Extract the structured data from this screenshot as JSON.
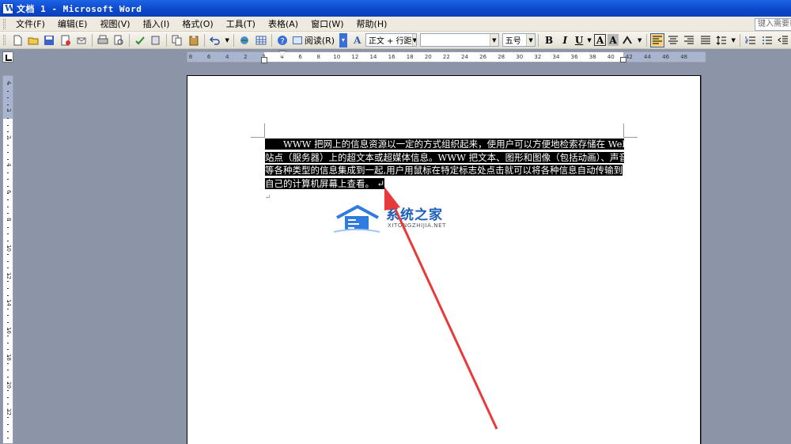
{
  "window": {
    "title": "文档 1 - Microsoft Word"
  },
  "menu": {
    "items": [
      "文件(F)",
      "编辑(E)",
      "视图(V)",
      "插入(I)",
      "格式(O)",
      "工具(T)",
      "表格(A)",
      "窗口(W)",
      "帮助(H)"
    ],
    "help_placeholder": "键入需要帮助的问题"
  },
  "toolbar": {
    "read_label": "阅读(R)",
    "style_value": "正文 + 行距",
    "font_value": "",
    "size_value": "五号",
    "bold": "B",
    "italic": "I",
    "underline": "U",
    "char_border": "A",
    "char_shade": "A"
  },
  "ruler": {
    "h_ticks": [
      "8",
      "6",
      "4",
      "2",
      "2",
      "4",
      "6",
      "8",
      "10",
      "12",
      "14",
      "16",
      "18",
      "20",
      "22",
      "24",
      "26",
      "28",
      "30",
      "32",
      "34",
      "36",
      "38",
      "40",
      "42",
      "44",
      "46",
      "48"
    ],
    "v_ticks": [
      "4",
      "2",
      "2",
      "4",
      "6",
      "8",
      "10",
      "12",
      "14",
      "16",
      "18",
      "20",
      "22"
    ]
  },
  "document": {
    "lines": [
      "　　WWW 把网上的信息资源以一定的方式组织起来，使用户可以方便地检索存储在 Web",
      "站点（服务器）上的超文本或超媒体信息。WWW 把文本、图形和图像（包括动画）、声音",
      "等各种类型的信息集成到一起,用户用鼠标在特定标志处点击就可以将各种信息自动传输到",
      "自己的计算机屏幕上查看。"
    ],
    "para_mark": "↵"
  },
  "watermark": {
    "title": "系统之家",
    "subtitle": "XITONGZHIJIA.NET"
  },
  "colors": {
    "title_bar": "#0b47c9",
    "annotation_arrow": "#e83a3a",
    "watermark_blue": "#1d5fb8"
  }
}
